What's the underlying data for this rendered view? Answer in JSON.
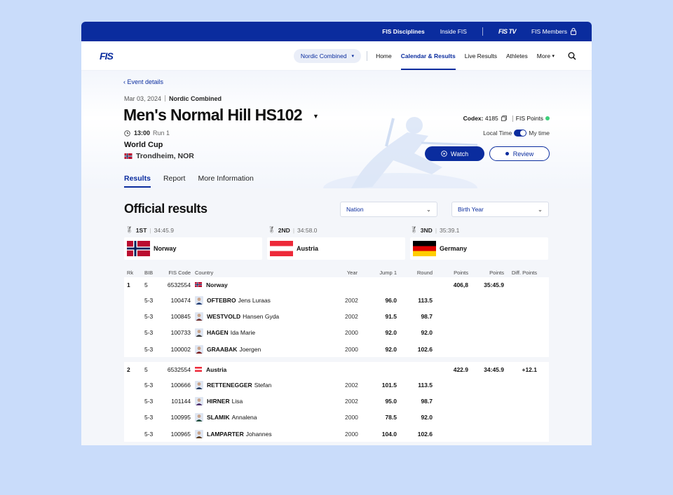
{
  "topbar": {
    "disciplines": "FIS Disciplines",
    "inside": "Inside FIS",
    "tv": "FIS TV",
    "members": "FIS Members"
  },
  "nav": {
    "logo": "FIS",
    "discipline": "Nordic Combined",
    "links": [
      "Home",
      "Calendar & Results",
      "Live Results",
      "Athletes",
      "More"
    ]
  },
  "event": {
    "back": "Event details",
    "date": "Mar 03, 2024",
    "discipline": "Nordic Combined",
    "title": "Men's Normal Hill HS102",
    "time": "13:00",
    "run": "Run 1",
    "series": "World Cup",
    "location": "Trondheim, NOR",
    "codex_label": "Codex:",
    "codex": "4185",
    "fis_points": "FIS Points",
    "local_time": "Local Time",
    "my_time": "My time",
    "watch": "Watch",
    "review": "Review"
  },
  "tabs": [
    "Results",
    "Report",
    "More Information"
  ],
  "results": {
    "title": "Official results",
    "filter_nation": "Nation",
    "filter_birth": "Birth Year",
    "podium": [
      {
        "place": "1ST",
        "time": "34:45.9",
        "country": "Norway"
      },
      {
        "place": "2ND",
        "time": "34:58.0",
        "country": "Austria"
      },
      {
        "place": "3ND",
        "time": "35:39.1",
        "country": "Germany"
      }
    ],
    "headers": [
      "Rk",
      "BIB",
      "FIS Code",
      "Country",
      "Year",
      "Jump 1",
      "Round",
      "Points",
      "Points",
      "Diff. Points"
    ],
    "teams": [
      {
        "rk": "1",
        "bib": "5",
        "code": "6532554",
        "country": "Norway",
        "points": "406,8",
        "time": "35:45.9",
        "diff": "",
        "athletes": [
          {
            "bib": "5-3",
            "code": "100474",
            "last": "OFTEBRO",
            "first": "Jens Luraas",
            "year": "2002",
            "jump": "96.0",
            "round": "113.5"
          },
          {
            "bib": "5-3",
            "code": "100845",
            "last": "WESTVOLD",
            "first": "Hansen Gyda",
            "year": "2002",
            "jump": "91.5",
            "round": "98.7"
          },
          {
            "bib": "5-3",
            "code": "100733",
            "last": "HAGEN",
            "first": "Ida Marie",
            "year": "2000",
            "jump": "92.0",
            "round": "92.0"
          },
          {
            "bib": "5-3",
            "code": "100002",
            "last": "GRAABAK",
            "first": "Joergen",
            "year": "2000",
            "jump": "92.0",
            "round": "102.6"
          }
        ]
      },
      {
        "rk": "2",
        "bib": "5",
        "code": "6532554",
        "country": "Austria",
        "points": "422.9",
        "time": "34:45.9",
        "diff": "+12.1",
        "athletes": [
          {
            "bib": "5-3",
            "code": "100666",
            "last": "RETTENEGGER",
            "first": "Stefan",
            "year": "2002",
            "jump": "101.5",
            "round": "113.5"
          },
          {
            "bib": "5-3",
            "code": "101144",
            "last": "HIRNER",
            "first": "Lisa",
            "year": "2002",
            "jump": "95.0",
            "round": "98.7"
          },
          {
            "bib": "5-3",
            "code": "100995",
            "last": "SLAMIK",
            "first": "Annalena",
            "year": "2000",
            "jump": "78.5",
            "round": "92.0"
          },
          {
            "bib": "5-3",
            "code": "100965",
            "last": "LAMPARTER",
            "first": "Johannes",
            "year": "2000",
            "jump": "104.0",
            "round": "102.6"
          }
        ]
      }
    ]
  },
  "colors": {
    "brand": "#0a2c9e",
    "background": "#c9dcfa",
    "status_green": "#3ccf7a"
  }
}
